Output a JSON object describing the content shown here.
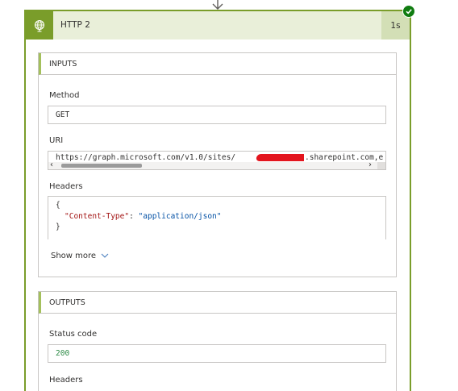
{
  "action": {
    "title": "HTTP 2",
    "duration": "1s",
    "status": "succeeded"
  },
  "inputs": {
    "section_title": "INPUTS",
    "method_label": "Method",
    "method_value": "GET",
    "uri_label": "URI",
    "uri_prefix": "https://graph.microsoft.com/v1.0/sites/",
    "uri_suffix": ".sharepoint.com,e",
    "headers_label": "Headers",
    "headers_open": "{",
    "header_key": "\"Content-Type\"",
    "header_sep": ": ",
    "header_value": "\"application/json\"",
    "headers_close": "}",
    "show_more": "Show more"
  },
  "outputs": {
    "section_title": "OUTPUTS",
    "status_label": "Status code",
    "status_value": "200",
    "headers_label": "Headers"
  },
  "colors": {
    "accent": "#7a9d2a",
    "header_bg": "#e9efd9",
    "success": "#107c10",
    "json_key": "#a31515",
    "json_string": "#0451a5",
    "status_number": "#2c8a45"
  },
  "icons": [
    "down-arrow-icon",
    "globe-icon",
    "success-check-icon",
    "chevron-down-icon",
    "scroll-left-icon",
    "scroll-right-icon"
  ]
}
